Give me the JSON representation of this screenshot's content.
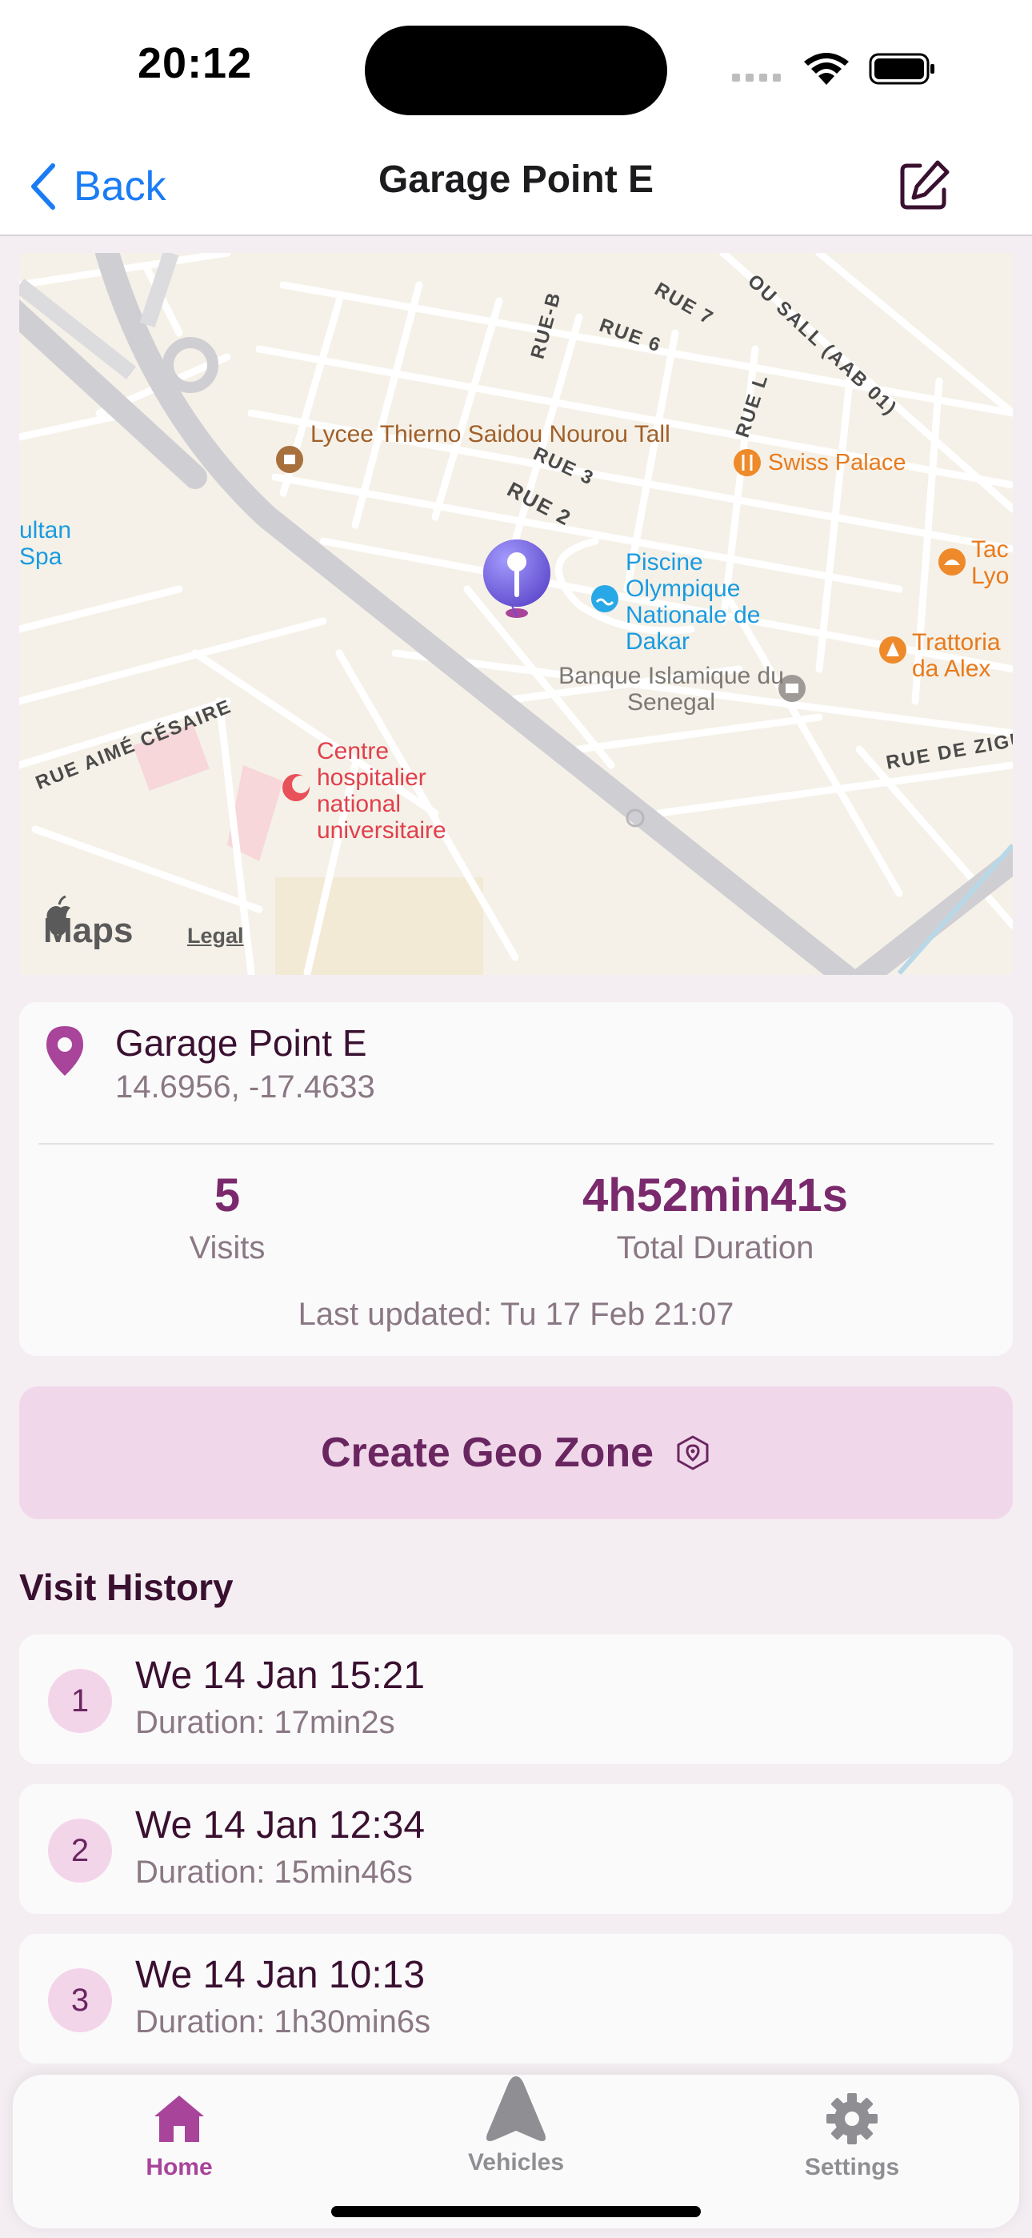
{
  "status_bar": {
    "time": "20:12"
  },
  "nav": {
    "back_label": "Back",
    "title": "Garage Point E"
  },
  "map": {
    "labels": {
      "lycee": "Lycee Thierno Saidou Nourou Tall",
      "swiss_palace": "Swiss Palace",
      "piscine": "Piscine Olympique Nationale de Dakar",
      "banque": "Banque Islamique du Senegal",
      "trattoria": "Trattoria da Alex",
      "taco_lyon": "Tac Lyo",
      "sultan_spa": "ultan Spa",
      "centre": "Centre hospitalier national universitaire"
    },
    "streets": {
      "rue_b": "RUE-B",
      "rue_6": "RUE 6",
      "rue_7": "RUE 7",
      "rue_3": "RUE 3",
      "rue_2": "RUE 2",
      "rue_l": "RUE L",
      "sall": "OU SALL (AAB 01)",
      "aime_cesaire": "RUE AIMÉ CÉSAIRE",
      "de_zigu": "RUE DE ZIGU"
    },
    "logo": "Maps",
    "legal": "Legal"
  },
  "location": {
    "name": "Garage Point E",
    "coords": "14.6956, -17.4633",
    "visits_value": "5",
    "visits_label": "Visits",
    "duration_value": "4h52min41s",
    "duration_label": "Total Duration",
    "last_updated": "Last updated: Tu 17 Feb 21:07"
  },
  "geo_button": {
    "label": "Create Geo Zone"
  },
  "visit_history": {
    "title": "Visit History",
    "items": [
      {
        "num": "1",
        "date": "We 14 Jan 15:21",
        "duration": "Duration: 17min2s"
      },
      {
        "num": "2",
        "date": "We 14 Jan 12:34",
        "duration": "Duration: 15min46s"
      },
      {
        "num": "3",
        "date": "We 14 Jan 10:13",
        "duration": "Duration: 1h30min6s"
      }
    ]
  },
  "tabs": [
    {
      "label": "Home",
      "active": true
    },
    {
      "label": "Vehicles",
      "active": false
    },
    {
      "label": "Settings",
      "active": false
    }
  ],
  "colors": {
    "accent": "#a8449a",
    "link": "#1a7cf5",
    "geo_button_bg": "#f0d8ea"
  }
}
